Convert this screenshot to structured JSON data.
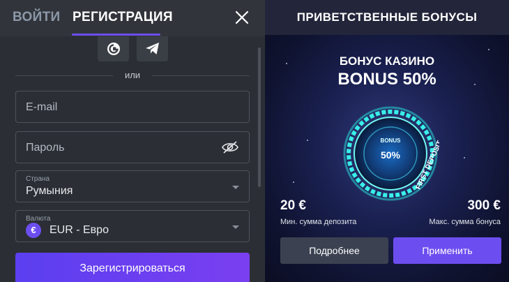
{
  "auth": {
    "tabs": [
      {
        "label": "ВОЙТИ",
        "active": false
      },
      {
        "label": "РЕГИСТРАЦИЯ",
        "active": true
      }
    ],
    "social": [
      "google-icon",
      "telegram-icon"
    ],
    "divider_text": "или",
    "email": {
      "placeholder": "E-mail",
      "value": ""
    },
    "password": {
      "placeholder": "Пароль",
      "value": ""
    },
    "country": {
      "label": "Страна",
      "value": "Румыния"
    },
    "currency": {
      "label": "Валюта",
      "symbol": "€",
      "value": "EUR - Евро"
    },
    "submit_label": "Зарегистрироваться"
  },
  "bonus_panel": {
    "title": "ПРИВЕТСТВЕННЫЕ БОНУСЫ",
    "promo_line1": "БОНУС КАЗИНО",
    "promo_line2": "BONUS 50%",
    "badge": {
      "top": "BONUS",
      "percent": "50%",
      "ring_text": "FIRST DEPOSIT"
    },
    "min_deposit": {
      "value": "20 €",
      "label": "Мин. сумма депозита"
    },
    "max_bonus": {
      "value": "300 €",
      "label": "Макс. сумма бонуса"
    },
    "more_label": "Подробнее",
    "apply_label": "Применить"
  },
  "colors": {
    "accent": "#6c4ef0",
    "panel": "#2b2f35",
    "promo_bg": "#1a2050"
  }
}
